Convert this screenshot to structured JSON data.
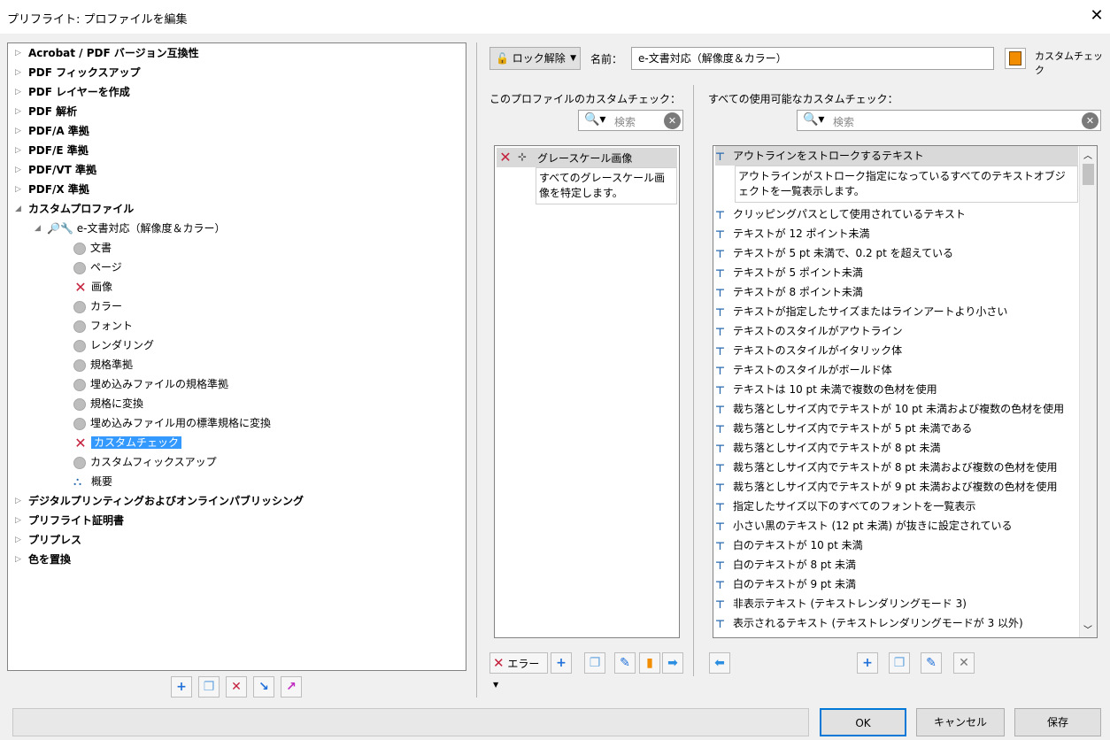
{
  "window": {
    "title": "プリフライト: プロファイルを編集",
    "close_glyph": "✕"
  },
  "tree": {
    "categories_top": [
      {
        "label": "Acrobat / PDF バージョン互換性"
      },
      {
        "label": "PDF フィックスアップ"
      },
      {
        "label": "PDF レイヤーを作成"
      },
      {
        "label": "PDF 解析"
      },
      {
        "label": "PDF/A 準拠"
      },
      {
        "label": "PDF/E 準拠"
      },
      {
        "label": "PDF/VT 準拠"
      },
      {
        "label": "PDF/X 準拠"
      }
    ],
    "custom_profiles": "カスタムプロファイル",
    "profile_name": "e-文書対応（解像度＆カラー）",
    "children": [
      {
        "label": "文書",
        "status": "none"
      },
      {
        "label": "ページ",
        "status": "none"
      },
      {
        "label": "画像",
        "status": "error"
      },
      {
        "label": "カラー",
        "status": "none"
      },
      {
        "label": "フォント",
        "status": "none"
      },
      {
        "label": "レンダリング",
        "status": "none"
      },
      {
        "label": "規格準拠",
        "status": "none"
      },
      {
        "label": "埋め込みファイルの規格準拠",
        "status": "none"
      },
      {
        "label": "規格に変換",
        "status": "none"
      },
      {
        "label": "埋め込みファイル用の標準規格に変換",
        "status": "none"
      },
      {
        "label": "カスタムチェック",
        "status": "error",
        "selected": true
      },
      {
        "label": "カスタムフィックスアップ",
        "status": "none"
      },
      {
        "label": "概要",
        "status": "summary"
      }
    ],
    "categories_bottom": [
      {
        "label": "デジタルプリンティングおよびオンラインパブリッシング"
      },
      {
        "label": "プリフライト証明書"
      },
      {
        "label": "プリプレス"
      },
      {
        "label": "色を置換"
      }
    ]
  },
  "header": {
    "unlock_label": "ロック解除",
    "name_label": "名前：",
    "name_value": "e-文書対応（解像度＆カラー）",
    "custom_check_label": "カスタムチェック"
  },
  "profile_checks": {
    "title": "このプロファイルのカスタムチェック：",
    "search_placeholder": "検索",
    "item_name": "グレースケール画像",
    "item_desc": "すべてのグレースケール画像を特定します。",
    "severity_label": "エラー"
  },
  "all_checks": {
    "title": "すべての使用可能なカスタムチェック：",
    "search_placeholder": "検索",
    "selected_desc": "アウトラインがストローク指定になっているすべてのテキストオブジェクトを一覧表示します。",
    "items": [
      "アウトラインをストロークするテキスト",
      "クリッピングパスとして使用されているテキスト",
      "テキストが 12 ポイント未満",
      "テキストが 5 pt 未満で、0.2 pt を超えている",
      "テキストが 5 ポイント未満",
      "テキストが 8 ポイント未満",
      "テキストが指定したサイズまたはラインアートより小さい",
      "テキストのスタイルがアウトライン",
      "テキストのスタイルがイタリック体",
      "テキストのスタイルがボールド体",
      "テキストは 10 pt 未満で複数の色材を使用",
      "裁ち落としサイズ内でテキストが 10 pt 未満および複数の色材を使用",
      "裁ち落としサイズ内でテキストが 5 pt 未満である",
      "裁ち落としサイズ内でテキストが 8 pt 未満",
      "裁ち落としサイズ内でテキストが 8 pt 未満および複数の色材を使用",
      "裁ち落としサイズ内でテキストが 9 pt 未満および複数の色材を使用",
      "指定したサイズ以下のすべてのフォントを一覧表示",
      "小さい黒のテキスト (12 pt 未満) が抜きに設定されている",
      "白のテキストが 10 pt 未満",
      "白のテキストが 8 pt 未満",
      "白のテキストが 9 pt 未満",
      "非表示テキスト (テキストレンダリングモード 3)",
      "表示されるテキスト (テキストレンダリングモードが 3 以外)"
    ]
  },
  "footer": {
    "ok": "OK",
    "cancel": "キャンセル",
    "save": "保存"
  },
  "colors": {
    "selection": "#3399ff",
    "error": "#c4203c",
    "ok_border": "#0078d7"
  }
}
